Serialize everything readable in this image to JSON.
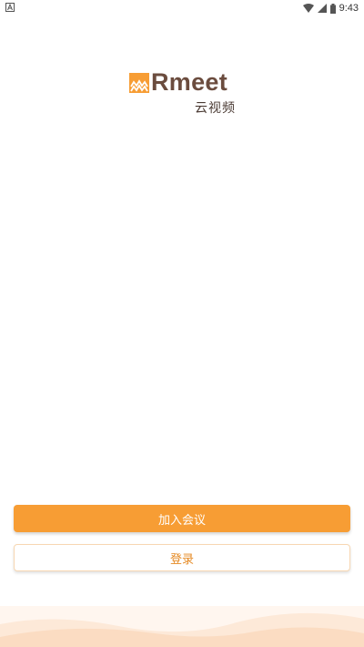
{
  "status_bar": {
    "time": "9:43",
    "icons": [
      "notification-icon",
      "wifi-icon",
      "cell-signal-icon",
      "battery-icon"
    ]
  },
  "logo": {
    "wordmark": "Rmeet",
    "subtitle": "云视频",
    "brand_color": "#f79d34"
  },
  "actions": {
    "join_label": "加入会议",
    "login_label": "登录"
  },
  "colors": {
    "primary": "#f79d34",
    "login_text": "#e58a24",
    "wordmark": "#6b4c3e"
  }
}
